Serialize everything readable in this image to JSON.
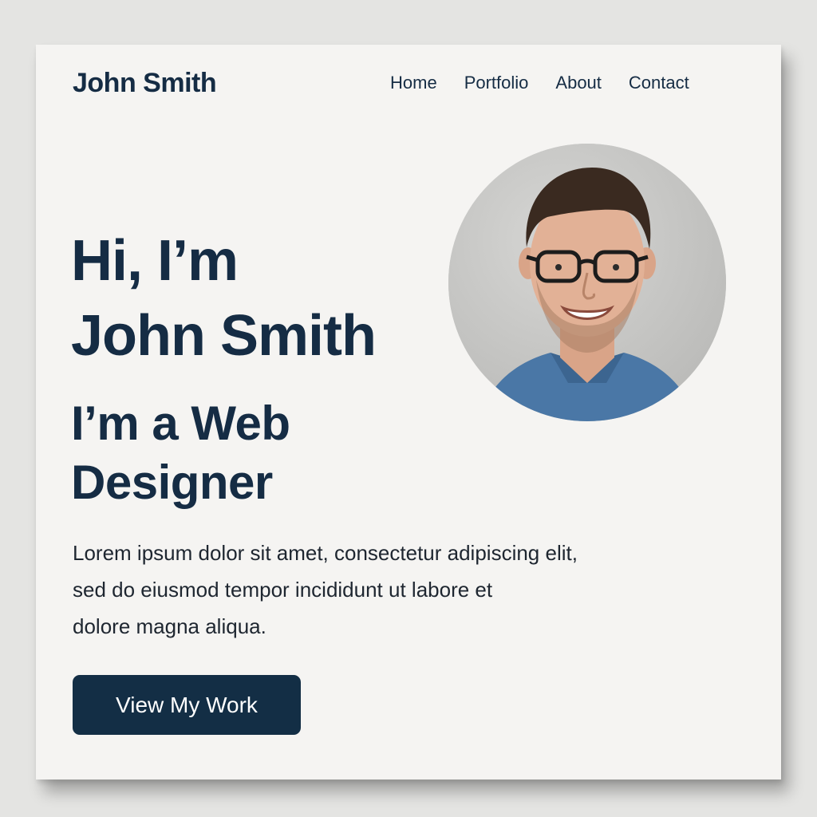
{
  "header": {
    "brand": "John Smith",
    "nav": [
      "Home",
      "Portfolio",
      "About",
      "Contact"
    ]
  },
  "hero": {
    "title_lines": [
      "Hi, I’m",
      "John Smith"
    ],
    "subtitle_lines": [
      "I’m a Web",
      "Designer"
    ],
    "intro_lines": [
      "Lorem ipsum dolor sit amet, consectetur adipiscing elit,",
      "sed do eiusmod tempor incididunt ut labore et",
      "dolore magna aliqua."
    ],
    "cta_label": "View My Work"
  },
  "colors": {
    "page_background": "#e4e4e2",
    "card_background": "#f5f4f2",
    "text_primary": "#152c44",
    "button_background": "#132e45",
    "button_text": "#ffffff",
    "avatar_background": "#c9c9c7",
    "shirt": "#4a77a6"
  }
}
